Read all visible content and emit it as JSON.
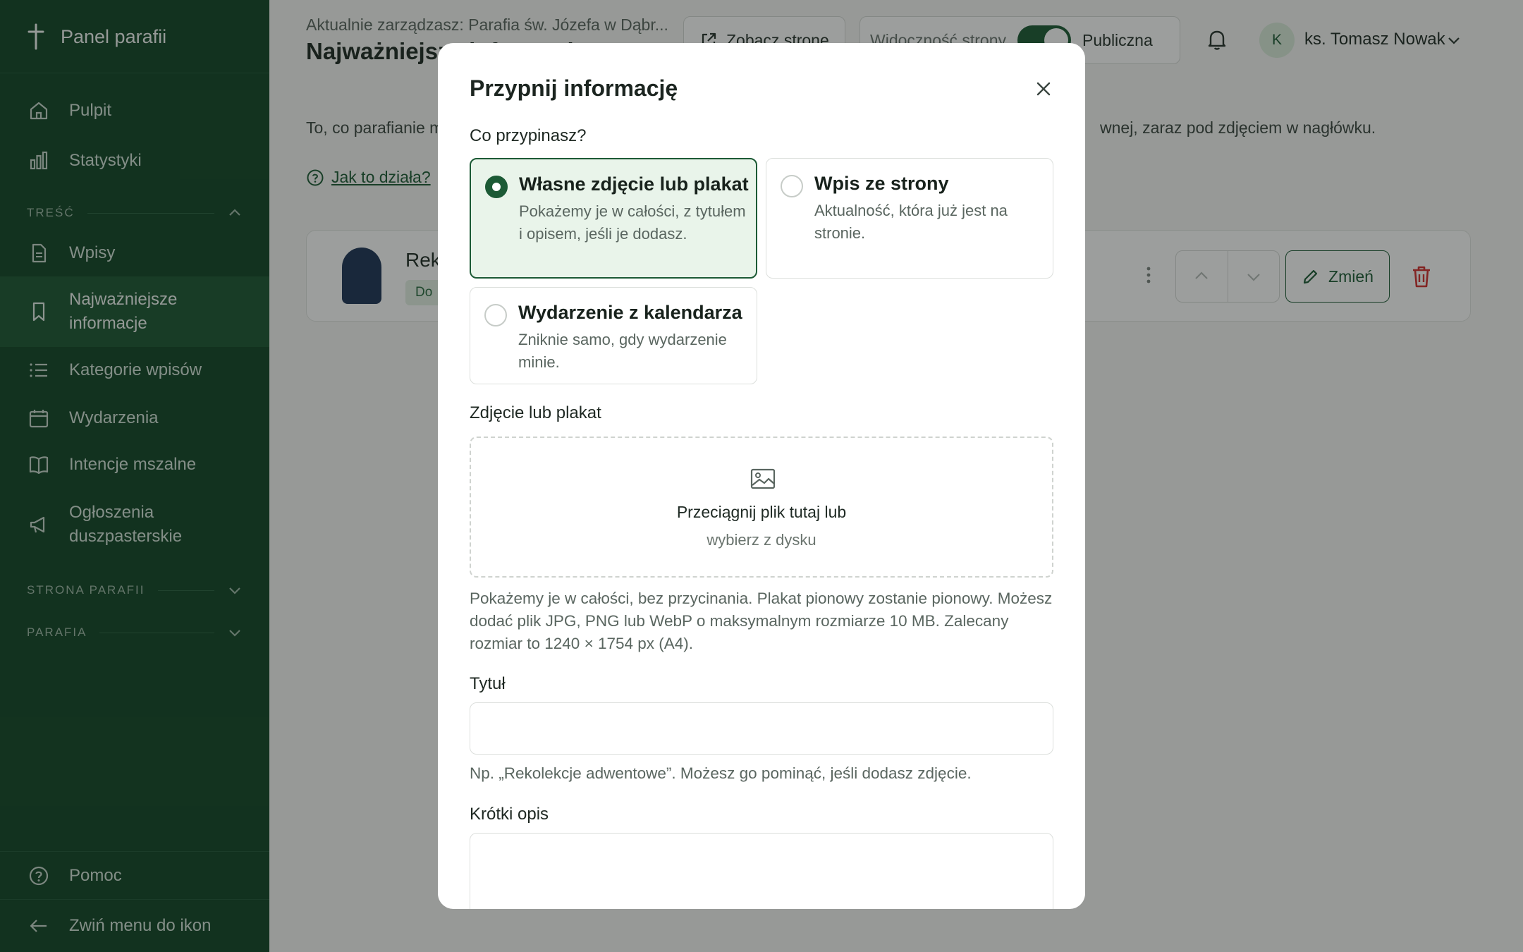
{
  "sidebar": {
    "brand": "Panel parafii",
    "items": [
      {
        "label": "Pulpit",
        "icon": "home-icon"
      },
      {
        "label": "Statystyki",
        "icon": "bar-chart-icon"
      },
      {
        "label": "Wpisy",
        "icon": "document-icon"
      },
      {
        "label": "Najważniejsze informacje",
        "icon": "bookmark-icon",
        "active": true
      },
      {
        "label": "Kategorie wpisów",
        "icon": "list-icon"
      },
      {
        "label": "Wydarzenia",
        "icon": "calendar-icon"
      },
      {
        "label": "Intencje mszalne",
        "icon": "book-icon"
      },
      {
        "label": "Ogłoszenia duszpasterskie",
        "icon": "megaphone-icon"
      }
    ],
    "sections": {
      "content": "TREŚĆ",
      "site": "STRONA PARAFII",
      "parish": "PARAFIA"
    },
    "help": "Pomoc",
    "collapse": "Zwiń menu do ikon"
  },
  "header": {
    "subtitle": "Aktualnie zarządzasz: Parafia św. Józefa w Dąbr...",
    "title": "Najważniejsze informacje",
    "view_page": "Zobacz stronę",
    "visibility_label": "Widoczność strony",
    "visibility_value": "Publiczna",
    "avatar_initial": "K",
    "user": "ks. Tomasz Nowak"
  },
  "main": {
    "intro_left": "To, co parafianie m",
    "intro_right": "wnej, zaraz pod zdjęciem w nagłówku.",
    "how_link": "Jak to działa?",
    "card": {
      "title": "Rek",
      "badge": "Do",
      "edit": "Zmień"
    }
  },
  "modal": {
    "title": "Przypnij informację",
    "question": "Co przypinasz?",
    "options": [
      {
        "title": "Własne zdjęcie lub plakat",
        "desc": "Pokażemy je w całości, z tytułem i opisem, jeśli je dodasz.",
        "selected": true
      },
      {
        "title": "Wpis ze strony",
        "desc": "Aktualność, która już jest na stronie.",
        "selected": false
      },
      {
        "title": "Wydarzenie z kalendarza",
        "desc": "Zniknie samo, gdy wydarzenie minie.",
        "selected": false
      }
    ],
    "photo_label": "Zdjęcie lub plakat",
    "dropzone_main": "Przeciągnij plik tutaj lub",
    "dropzone_sub": "wybierz z dysku",
    "photo_help": "Pokażemy je w całości, bez przycinania. Plakat pionowy zostanie pionowy. Możesz dodać plik JPG, PNG lub WebP o maksymalnym rozmiarze 10 MB. Zalecany rozmiar to 1240 × 1754 px (A4).",
    "title_label": "Tytuł",
    "title_value": "",
    "title_help": "Np. „Rekolekcje adwentowe”. Możesz go pominąć, jeśli dodasz zdjęcie.",
    "desc_label": "Krótki opis",
    "desc_value": ""
  },
  "colors": {
    "sidebar_bg": "#124526",
    "accent": "#1c5a35",
    "danger": "#d32f2f"
  }
}
